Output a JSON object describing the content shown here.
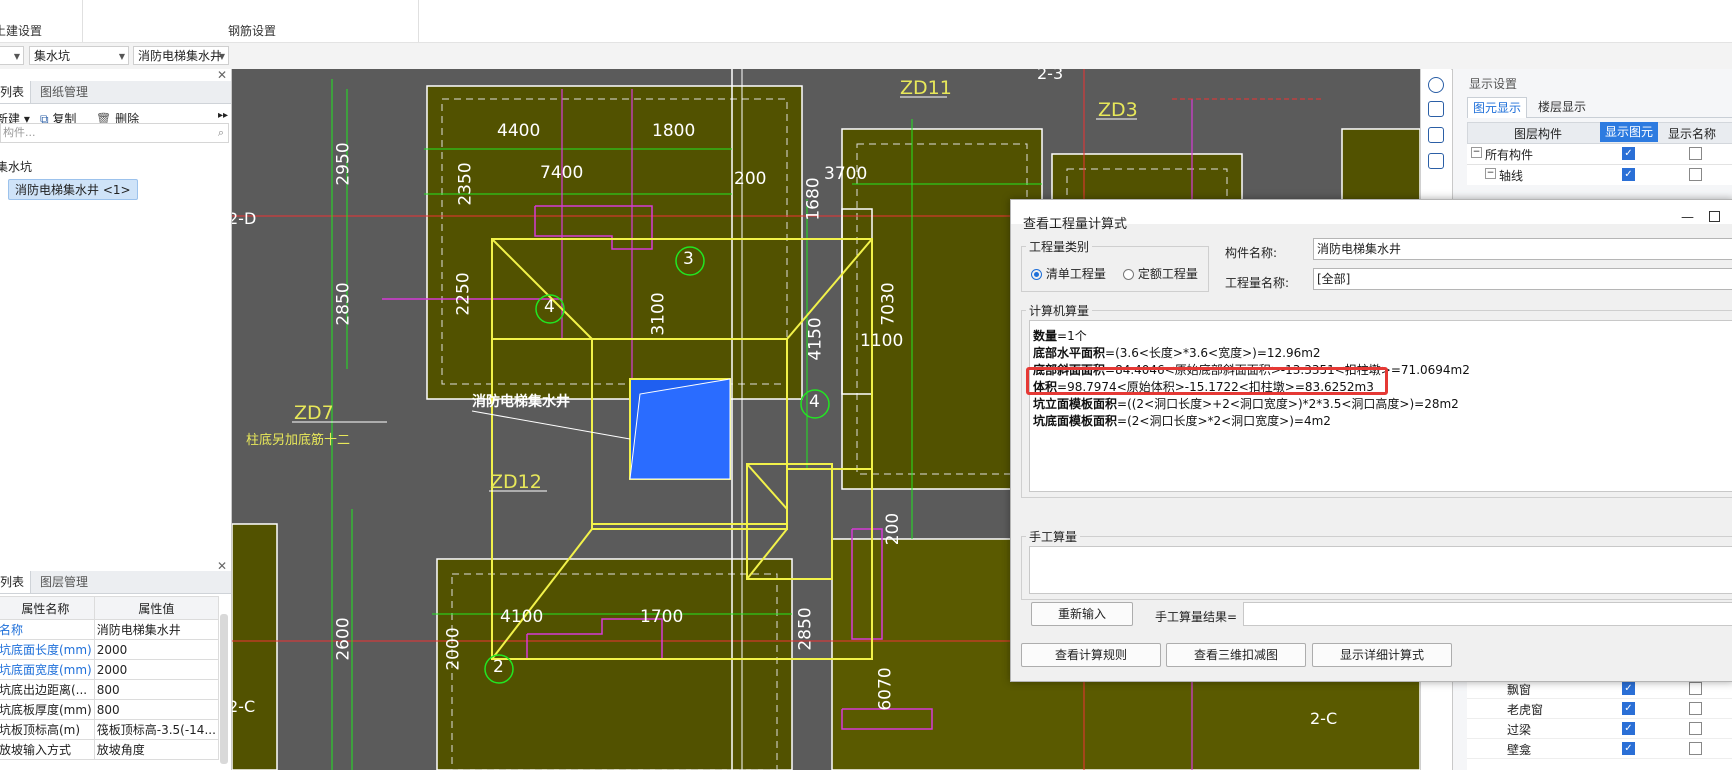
{
  "ribbon": {
    "sections": [
      "土建设置",
      "钢筋设置"
    ]
  },
  "toolbar": {
    "combo1": "",
    "combo2": "集水坑",
    "combo3": "消防电梯集水井"
  },
  "left_top": {
    "tabs": [
      "列表",
      "图纸管理"
    ],
    "new_label": "新建",
    "copy_label": "复制",
    "delete_label": "删除",
    "search_placeholder": "构件...",
    "tree_parent": "集水坑",
    "tree_item": "消防电梯集水井 <1>"
  },
  "left_bottom": {
    "tabs": [
      "列表",
      "图层管理"
    ],
    "col_name": "属性名称",
    "col_value": "属性值",
    "rows": [
      {
        "name": "名称",
        "value": "消防电梯集水井"
      },
      {
        "name": "坑底面长度(mm)",
        "value": "2000"
      },
      {
        "name": "坑底面宽度(mm)",
        "value": "2000"
      },
      {
        "name": "坑底出边距离(...",
        "value": "800"
      },
      {
        "name": "坑底板厚度(mm)",
        "value": "800"
      },
      {
        "name": "坑板顶标高(m)",
        "value": "筏板顶标高-3.5(-14..."
      },
      {
        "name": "放坡输入方式",
        "value": "放坡角度"
      }
    ]
  },
  "canvas": {
    "dims": [
      "4400",
      "1800",
      "7400",
      "2950",
      "2350",
      "2250",
      "2850",
      "3100",
      "3700",
      "1680",
      "4150",
      "7030",
      "1100",
      "200",
      "4100",
      "1700",
      "2000",
      "2600",
      "2850",
      "6070",
      "200",
      "200"
    ],
    "labels": [
      "ZD11",
      "ZD3",
      "ZD7",
      "ZD12",
      "2-3",
      "2-D",
      "2-C",
      "2-C"
    ],
    "circles": [
      "3",
      "4",
      "4",
      "2"
    ],
    "pit_label": "消防电梯集水井",
    "note_label": "柱底另加底筋十二"
  },
  "right_panel": {
    "title": "显示设置",
    "tabs": [
      "图元显示",
      "楼层显示"
    ],
    "col1": "图层构件",
    "col2": "显示图元",
    "col3": "显示名称",
    "rows_top": [
      {
        "label": "所有构件",
        "show": true,
        "name": false
      },
      {
        "label": "轴线",
        "show": true,
        "name": false
      }
    ],
    "rows_bottom": [
      {
        "label": "飘窗",
        "show": true,
        "name": false
      },
      {
        "label": "老虎窗",
        "show": true,
        "name": false
      },
      {
        "label": "过梁",
        "show": true,
        "name": false
      },
      {
        "label": "壁龛",
        "show": true,
        "name": false
      }
    ]
  },
  "dialog": {
    "title": "查看工程量计算式",
    "qty_group": "工程量类别",
    "radio1": "清单工程量",
    "radio2": "定额工程量",
    "component_name_label": "构件名称:",
    "component_name_value": "消防电梯集水井",
    "qty_name_label": "工程量名称:",
    "qty_name_value": "[全部]",
    "calc_group": "计算机算量",
    "formulas": [
      {
        "name": "数量",
        "expr": "=1个"
      },
      {
        "name": "底部水平面积",
        "expr": "=(3.6<长度>*3.6<宽度>)=12.96m2"
      },
      {
        "name": "底部斜面面积",
        "expr": "=84.4046<原始底部斜面面积>-13.3351<扣柱墩>=71.0694m2"
      },
      {
        "name": "体积",
        "expr": "=98.7974<原始体积>-15.1722<扣柱墩>=83.6252m3"
      },
      {
        "name": "坑立面模板面积",
        "expr": "=((2<洞口长度>+2<洞口宽度>)*2*3.5<洞口高度>)=28m2"
      },
      {
        "name": "坑底面模板面积",
        "expr": "=(2<洞口长度>*2<洞口宽度>)=4m2"
      }
    ],
    "manual_group": "手工算量",
    "reinput": "重新输入",
    "manual_result_label": "手工算量结果=",
    "btn_rule": "查看计算规则",
    "btn_3d": "查看三维扣减图",
    "btn_detail": "显示详细计算式",
    "highlight_color": "#e53935"
  },
  "colors": {
    "accent": "#1e6fd9",
    "canvas_bg": "#5b5b5b",
    "olive": "#525200",
    "yellow": "#f2f24a",
    "magenta": "#d63bd6",
    "green": "#22e622",
    "red": "#e33",
    "pit_blue": "#1f5ff0"
  }
}
